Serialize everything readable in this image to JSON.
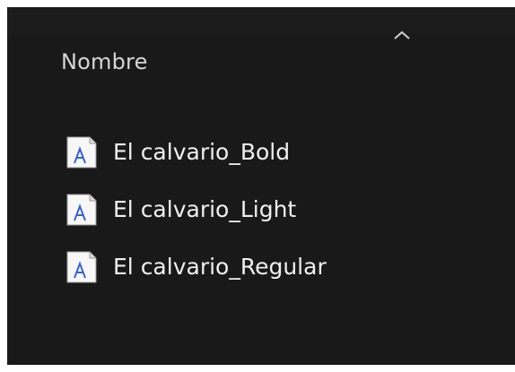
{
  "header": {
    "column_name": "Nombre",
    "sort_icon": "chevron-up-icon"
  },
  "files": [
    {
      "name": "El calvario_Bold",
      "icon": "font-file-icon"
    },
    {
      "name": "El calvario_Light",
      "icon": "font-file-icon"
    },
    {
      "name": "El calvario_Regular",
      "icon": "font-file-icon"
    }
  ],
  "colors": {
    "background": "#191919",
    "header_text": "#d6d6d6",
    "file_text": "#f0f0f0",
    "icon_glyph": "#3b63c9"
  }
}
